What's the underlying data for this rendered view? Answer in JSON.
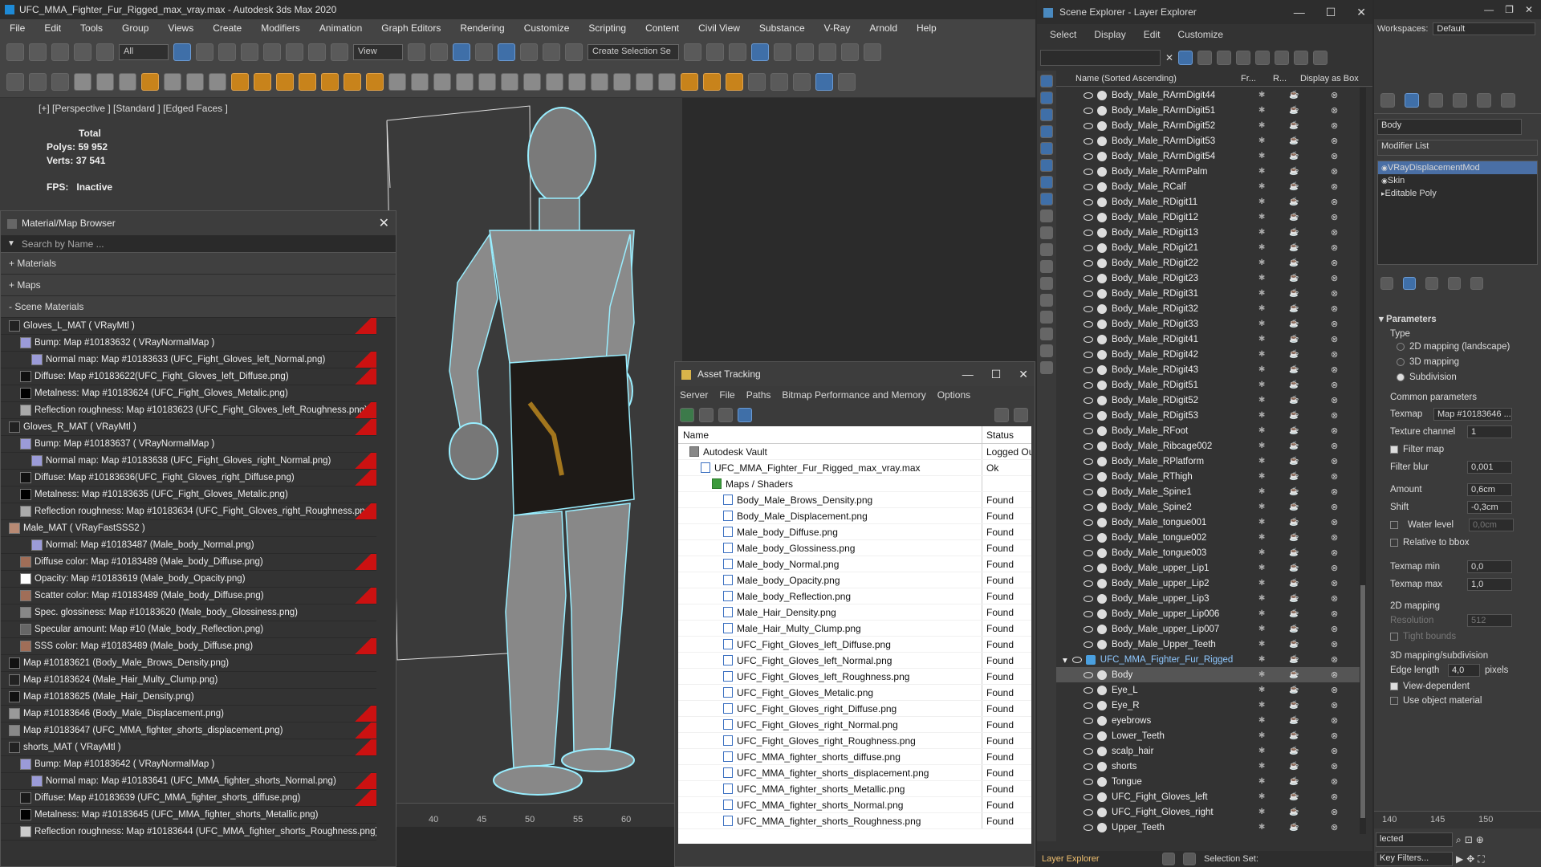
{
  "app": {
    "title": "UFC_MMA_Fighter_Fur_Rigged_max_vray.max - Autodesk 3ds Max 2020"
  },
  "menu": [
    "File",
    "Edit",
    "Tools",
    "Group",
    "Views",
    "Create",
    "Modifiers",
    "Animation",
    "Graph Editors",
    "Rendering",
    "Customize",
    "Scripting",
    "Content",
    "Civil View",
    "Substance",
    "V-Ray",
    "Arnold",
    "Help"
  ],
  "toolbar": {
    "filter_all": "All",
    "view_dropdown": "View",
    "selection_set": "Create Selection Se"
  },
  "viewport": {
    "label": "[+] [Perspective ] [Standard ] [Edged Faces ]",
    "stats": {
      "total": "Total",
      "polys_label": "Polys:",
      "polys": "59 952",
      "verts_label": "Verts:",
      "verts": "37 541",
      "fps_label": "FPS:",
      "fps": "Inactive"
    },
    "ruler_ticks": [
      "40",
      "45",
      "50",
      "55",
      "60"
    ]
  },
  "material_browser": {
    "title": "Material/Map Browser",
    "search_placeholder": "Search by Name ...",
    "sections": [
      "+ Materials",
      "+ Maps",
      "- Scene Materials"
    ],
    "items": [
      {
        "text": "Gloves_L_MAT  ( VRayMtl )",
        "indent": 0,
        "swatch": "#222",
        "red": true
      },
      {
        "text": "Bump: Map #10183632  ( VRayNormalMap )",
        "indent": 1,
        "swatch": "#9b9bd8",
        "red": false
      },
      {
        "text": "Normal map: Map #10183633 (UFC_Fight_Gloves_left_Normal.png)",
        "indent": 2,
        "swatch": "#9b9bd8",
        "red": true
      },
      {
        "text": "Diffuse: Map #10183622(UFC_Fight_Gloves_left_Diffuse.png)",
        "indent": 1,
        "swatch": "#111",
        "red": true
      },
      {
        "text": "Metalness: Map #10183624 (UFC_Fight_Gloves_Metalic.png)",
        "indent": 1,
        "swatch": "#000",
        "red": false
      },
      {
        "text": "Reflection roughness: Map #10183623 (UFC_Fight_Gloves_left_Roughness.png)",
        "indent": 1,
        "swatch": "#aaa",
        "red": true
      },
      {
        "text": "Gloves_R_MAT  ( VRayMtl )",
        "indent": 0,
        "swatch": "#222",
        "red": true
      },
      {
        "text": "Bump: Map #10183637  ( VRayNormalMap )",
        "indent": 1,
        "swatch": "#9b9bd8",
        "red": false
      },
      {
        "text": "Normal map: Map #10183638 (UFC_Fight_Gloves_right_Normal.png)",
        "indent": 2,
        "swatch": "#9b9bd8",
        "red": true
      },
      {
        "text": "Diffuse: Map #10183636(UFC_Fight_Gloves_right_Diffuse.png)",
        "indent": 1,
        "swatch": "#111",
        "red": true
      },
      {
        "text": "Metalness: Map #10183635 (UFC_Fight_Gloves_Metalic.png)",
        "indent": 1,
        "swatch": "#000",
        "red": false
      },
      {
        "text": "Reflection roughness: Map #10183634 (UFC_Fight_Gloves_right_Roughness.png)",
        "indent": 1,
        "swatch": "#aaa",
        "red": true
      },
      {
        "text": "Male_MAT  ( VRayFastSSS2 )",
        "indent": 0,
        "swatch": "#b88a74",
        "red": false
      },
      {
        "text": "Normal: Map #10183487 (Male_body_Normal.png)",
        "indent": 2,
        "swatch": "#9b9bd8",
        "red": false
      },
      {
        "text": "Diffuse color: Map #10183489 (Male_body_Diffuse.png)",
        "indent": 1,
        "swatch": "#a06e58",
        "red": true
      },
      {
        "text": "Opacity: Map #10183619 (Male_body_Opacity.png)",
        "indent": 1,
        "swatch": "#fff",
        "red": false
      },
      {
        "text": "Scatter color: Map #10183489 (Male_body_Diffuse.png)",
        "indent": 1,
        "swatch": "#a06e58",
        "red": true
      },
      {
        "text": "Spec. glossiness: Map #10183620 (Male_body_Glossiness.png)",
        "indent": 1,
        "swatch": "#888",
        "red": false
      },
      {
        "text": "Specular amount: Map #10 (Male_body_Reflection.png)",
        "indent": 1,
        "swatch": "#666",
        "red": false
      },
      {
        "text": "SSS color: Map #10183489 (Male_body_Diffuse.png)",
        "indent": 1,
        "swatch": "#a06e58",
        "red": true
      },
      {
        "text": "Map #10183621 (Body_Male_Brows_Density.png)",
        "indent": 0,
        "swatch": "#111",
        "red": false
      },
      {
        "text": "Map #10183624 (Male_Hair_Multy_Clump.png)",
        "indent": 0,
        "swatch": "#222",
        "red": false
      },
      {
        "text": "Map #10183625 (Male_Hair_Density.png)",
        "indent": 0,
        "swatch": "#111",
        "red": false
      },
      {
        "text": "Map #10183646 (Body_Male_Displacement.png)",
        "indent": 0,
        "swatch": "#999",
        "red": true
      },
      {
        "text": "Map #10183647 (UFC_MMA_fighter_shorts_displacement.png)",
        "indent": 0,
        "swatch": "#888",
        "red": true
      },
      {
        "text": "shorts_MAT  ( VRayMtl )",
        "indent": 0,
        "swatch": "#222",
        "red": true
      },
      {
        "text": "Bump: Map #10183642  ( VRayNormalMap )",
        "indent": 1,
        "swatch": "#9b9bd8",
        "red": false
      },
      {
        "text": "Normal map: Map #10183641 (UFC_MMA_fighter_shorts_Normal.png)",
        "indent": 2,
        "swatch": "#9b9bd8",
        "red": true
      },
      {
        "text": "Diffuse: Map #10183639 (UFC_MMA_fighter_shorts_diffuse.png)",
        "indent": 1,
        "swatch": "#1a1a1a",
        "red": true
      },
      {
        "text": "Metalness: Map #10183645 (UFC_MMA_fighter_shorts_Metallic.png)",
        "indent": 1,
        "swatch": "#000",
        "red": false
      },
      {
        "text": "Reflection roughness: Map #10183644 (UFC_MMA_fighter_shorts_Roughness.png)",
        "indent": 1,
        "swatch": "#ccc",
        "red": false
      }
    ]
  },
  "asset_tracking": {
    "title": "Asset Tracking",
    "menu": [
      "Server",
      "File",
      "Paths",
      "Bitmap Performance and Memory",
      "Options"
    ],
    "columns": [
      "Name",
      "Status"
    ],
    "rows": [
      {
        "name": "Autodesk Vault",
        "status": "Logged Ou",
        "indent": 1,
        "icon": "vault"
      },
      {
        "name": "UFC_MMA_Fighter_Fur_Rigged_max_vray.max",
        "status": "Ok",
        "indent": 2,
        "icon": "file"
      },
      {
        "name": "Maps / Shaders",
        "status": "",
        "indent": 3,
        "icon": "maps"
      },
      {
        "name": "Body_Male_Brows_Density.png",
        "status": "Found",
        "indent": 4,
        "icon": "file"
      },
      {
        "name": "Body_Male_Displacement.png",
        "status": "Found",
        "indent": 4,
        "icon": "file"
      },
      {
        "name": "Male_body_Diffuse.png",
        "status": "Found",
        "indent": 4,
        "icon": "file"
      },
      {
        "name": "Male_body_Glossiness.png",
        "status": "Found",
        "indent": 4,
        "icon": "file"
      },
      {
        "name": "Male_body_Normal.png",
        "status": "Found",
        "indent": 4,
        "icon": "file"
      },
      {
        "name": "Male_body_Opacity.png",
        "status": "Found",
        "indent": 4,
        "icon": "file"
      },
      {
        "name": "Male_body_Reflection.png",
        "status": "Found",
        "indent": 4,
        "icon": "file"
      },
      {
        "name": "Male_Hair_Density.png",
        "status": "Found",
        "indent": 4,
        "icon": "file"
      },
      {
        "name": "Male_Hair_Multy_Clump.png",
        "status": "Found",
        "indent": 4,
        "icon": "file"
      },
      {
        "name": "UFC_Fight_Gloves_left_Diffuse.png",
        "status": "Found",
        "indent": 4,
        "icon": "file"
      },
      {
        "name": "UFC_Fight_Gloves_left_Normal.png",
        "status": "Found",
        "indent": 4,
        "icon": "file"
      },
      {
        "name": "UFC_Fight_Gloves_left_Roughness.png",
        "status": "Found",
        "indent": 4,
        "icon": "file"
      },
      {
        "name": "UFC_Fight_Gloves_Metalic.png",
        "status": "Found",
        "indent": 4,
        "icon": "file"
      },
      {
        "name": "UFC_Fight_Gloves_right_Diffuse.png",
        "status": "Found",
        "indent": 4,
        "icon": "file"
      },
      {
        "name": "UFC_Fight_Gloves_right_Normal.png",
        "status": "Found",
        "indent": 4,
        "icon": "file"
      },
      {
        "name": "UFC_Fight_Gloves_right_Roughness.png",
        "status": "Found",
        "indent": 4,
        "icon": "file"
      },
      {
        "name": "UFC_MMA_fighter_shorts_diffuse.png",
        "status": "Found",
        "indent": 4,
        "icon": "file"
      },
      {
        "name": "UFC_MMA_fighter_shorts_displacement.png",
        "status": "Found",
        "indent": 4,
        "icon": "file"
      },
      {
        "name": "UFC_MMA_fighter_shorts_Metallic.png",
        "status": "Found",
        "indent": 4,
        "icon": "file"
      },
      {
        "name": "UFC_MMA_fighter_shorts_Normal.png",
        "status": "Found",
        "indent": 4,
        "icon": "file"
      },
      {
        "name": "UFC_MMA_fighter_shorts_Roughness.png",
        "status": "Found",
        "indent": 4,
        "icon": "file"
      }
    ]
  },
  "scene_explorer": {
    "title": "Scene Explorer - Layer Explorer",
    "menu": [
      "Select",
      "Display",
      "Edit",
      "Customize"
    ],
    "columns": {
      "name": "Name (Sorted Ascending)",
      "fr": "Fr...",
      "r": "R...",
      "display": "Display as Box"
    },
    "items": [
      {
        "name": "Body_Male_RArmDigit44",
        "level": 2
      },
      {
        "name": "Body_Male_RArmDigit51",
        "level": 2
      },
      {
        "name": "Body_Male_RArmDigit52",
        "level": 2
      },
      {
        "name": "Body_Male_RArmDigit53",
        "level": 2
      },
      {
        "name": "Body_Male_RArmDigit54",
        "level": 2
      },
      {
        "name": "Body_Male_RArmPalm",
        "level": 2
      },
      {
        "name": "Body_Male_RCalf",
        "level": 2
      },
      {
        "name": "Body_Male_RDigit11",
        "level": 2
      },
      {
        "name": "Body_Male_RDigit12",
        "level": 2
      },
      {
        "name": "Body_Male_RDigit13",
        "level": 2
      },
      {
        "name": "Body_Male_RDigit21",
        "level": 2
      },
      {
        "name": "Body_Male_RDigit22",
        "level": 2
      },
      {
        "name": "Body_Male_RDigit23",
        "level": 2
      },
      {
        "name": "Body_Male_RDigit31",
        "level": 2
      },
      {
        "name": "Body_Male_RDigit32",
        "level": 2
      },
      {
        "name": "Body_Male_RDigit33",
        "level": 2
      },
      {
        "name": "Body_Male_RDigit41",
        "level": 2
      },
      {
        "name": "Body_Male_RDigit42",
        "level": 2
      },
      {
        "name": "Body_Male_RDigit43",
        "level": 2
      },
      {
        "name": "Body_Male_RDigit51",
        "level": 2
      },
      {
        "name": "Body_Male_RDigit52",
        "level": 2
      },
      {
        "name": "Body_Male_RDigit53",
        "level": 2
      },
      {
        "name": "Body_Male_RFoot",
        "level": 2
      },
      {
        "name": "Body_Male_Ribcage002",
        "level": 2
      },
      {
        "name": "Body_Male_RPlatform",
        "level": 2
      },
      {
        "name": "Body_Male_RThigh",
        "level": 2
      },
      {
        "name": "Body_Male_Spine1",
        "level": 2
      },
      {
        "name": "Body_Male_Spine2",
        "level": 2
      },
      {
        "name": "Body_Male_tongue001",
        "level": 2
      },
      {
        "name": "Body_Male_tongue002",
        "level": 2
      },
      {
        "name": "Body_Male_tongue003",
        "level": 2
      },
      {
        "name": "Body_Male_upper_Lip1",
        "level": 2
      },
      {
        "name": "Body_Male_upper_Lip2",
        "level": 2
      },
      {
        "name": "Body_Male_upper_Lip3",
        "level": 2
      },
      {
        "name": "Body_Male_upper_Lip006",
        "level": 2
      },
      {
        "name": "Body_Male_upper_Lip007",
        "level": 2
      },
      {
        "name": "Body_Male_Upper_Teeth",
        "level": 2
      },
      {
        "name": "UFC_MMA_Fighter_Fur_Rigged",
        "level": 1,
        "layer": true
      },
      {
        "name": "Body",
        "level": 2,
        "selected": true
      },
      {
        "name": "Eye_L",
        "level": 2
      },
      {
        "name": "Eye_R",
        "level": 2
      },
      {
        "name": "eyebrows",
        "level": 2
      },
      {
        "name": "Lower_Teeth",
        "level": 2
      },
      {
        "name": "scalp_hair",
        "level": 2
      },
      {
        "name": "shorts",
        "level": 2
      },
      {
        "name": "Tongue",
        "level": 2
      },
      {
        "name": "UFC_Fight_Gloves_left",
        "level": 2
      },
      {
        "name": "UFC_Fight_Gloves_right",
        "level": 2
      },
      {
        "name": "Upper_Teeth",
        "level": 2
      }
    ],
    "footer": {
      "explorer": "Layer Explorer",
      "selection_set": "Selection Set:"
    }
  },
  "command_panel": {
    "workspaces_label": "Workspaces:",
    "workspace": "Default",
    "object_name": "Body",
    "modifier_list": "Modifier List",
    "stack": [
      "VRayDisplacementMod",
      "Skin",
      "Editable Poly"
    ],
    "params_title": "Parameters",
    "type_label": "Type",
    "types": [
      "2D mapping (landscape)",
      "3D mapping",
      "Subdivision"
    ],
    "common_label": "Common parameters",
    "texmap_label": "Texmap",
    "texmap": "Map #10183646 ...",
    "channel_label": "Texture channel",
    "channel": "1",
    "filter_map": "Filter map",
    "filter_blur_label": "Filter blur",
    "filter_blur": "0,001",
    "amount_label": "Amount",
    "amount": "0,6cm",
    "shift_label": "Shift",
    "shift": "-0,3cm",
    "water_label": "Water level",
    "water": "0,0cm",
    "relative_bbox": "Relative to bbox",
    "texmap_min_label": "Texmap min",
    "texmap_min": "0,0",
    "texmap_max_label": "Texmap max",
    "texmap_max": "1,0",
    "map2d_label": "2D mapping",
    "resolution_label": "Resolution",
    "resolution": "512",
    "tight_bounds": "Tight bounds",
    "subdiv_label": "3D mapping/subdivision",
    "edge_label": "Edge length",
    "edge": "4,0",
    "pixels": "pixels",
    "view_dep": "View-dependent",
    "use_obj": "Use object material",
    "ticks": [
      "140",
      "145",
      "150"
    ],
    "selected_dropdown": "lected",
    "key_filters": "Key Filters..."
  }
}
